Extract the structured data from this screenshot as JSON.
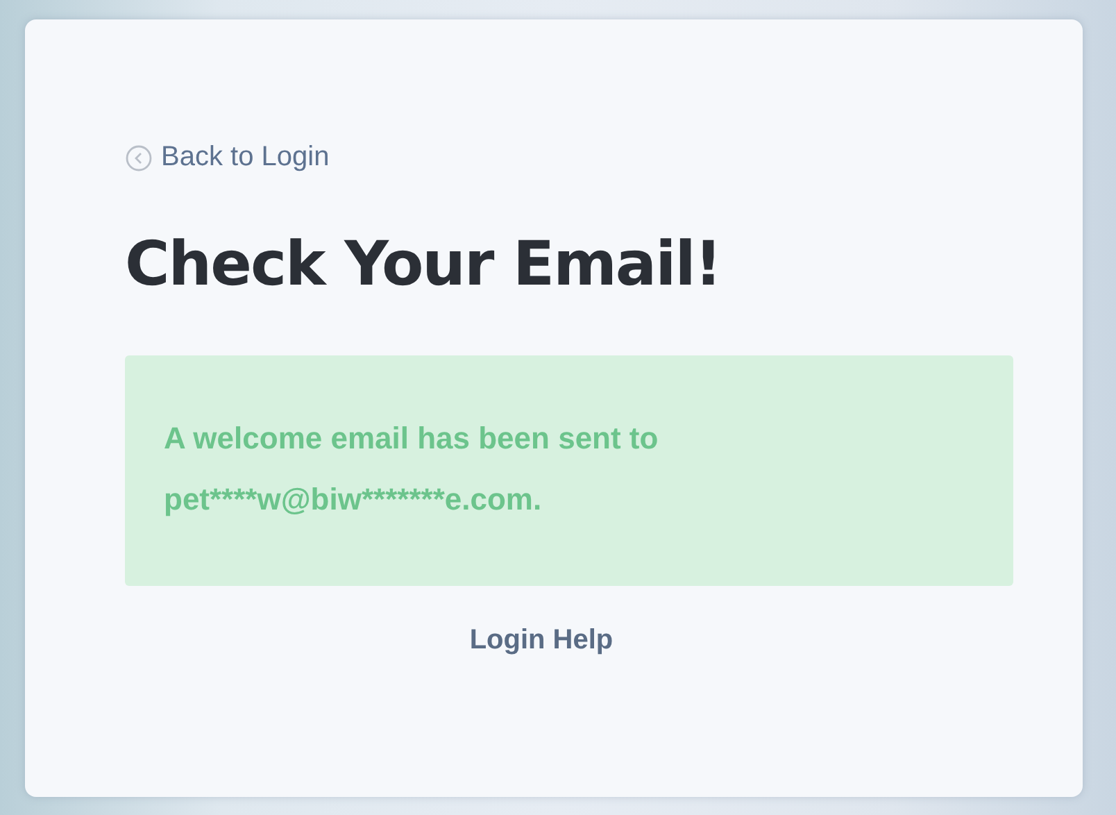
{
  "back_link": {
    "label": "Back to Login"
  },
  "heading": "Check Your Email!",
  "alert": {
    "message": "A welcome email has been sent to pet****w@biw*******e.com."
  },
  "help_link": {
    "label": "Login Help"
  }
}
